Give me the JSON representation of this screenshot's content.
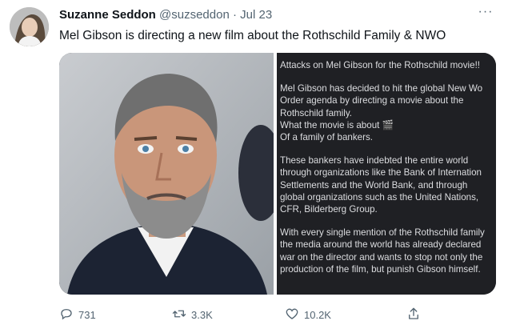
{
  "tweet": {
    "author_name": "Suzanne Seddon",
    "handle": "@suzseddon",
    "separator": "·",
    "date": "Jul 23",
    "more_label": "···",
    "text": "Mel Gibson is directing a new film about the Rothschild Family & NWO"
  },
  "media": {
    "screenshot_lines": [
      "Attacks on Mel Gibson for the Rothschild movie!!",
      "",
      "Mel Gibson has decided to hit the global New Wo",
      "Order agenda by directing a movie about the",
      "Rothschild family.",
      "What the movie is about 🎬",
      "Of a family of bankers.",
      "",
      "These bankers have indebted the entire world",
      "through organizations like the Bank of Internation",
      "Settlements and the World Bank, and through",
      "global organizations such as the United Nations,",
      "CFR, Bilderberg Group.",
      "",
      "With every single mention of the Rothschild family",
      "the media around the world has already declared",
      "war on the director and wants to stop not only the",
      "production of the film, but punish Gibson himself."
    ]
  },
  "actions": {
    "replies": "731",
    "retweets": "3.3K",
    "likes": "10.2K"
  },
  "icons": {
    "reply": "reply-icon",
    "retweet": "retweet-icon",
    "like": "heart-icon",
    "share": "share-icon",
    "more": "more-icon"
  }
}
